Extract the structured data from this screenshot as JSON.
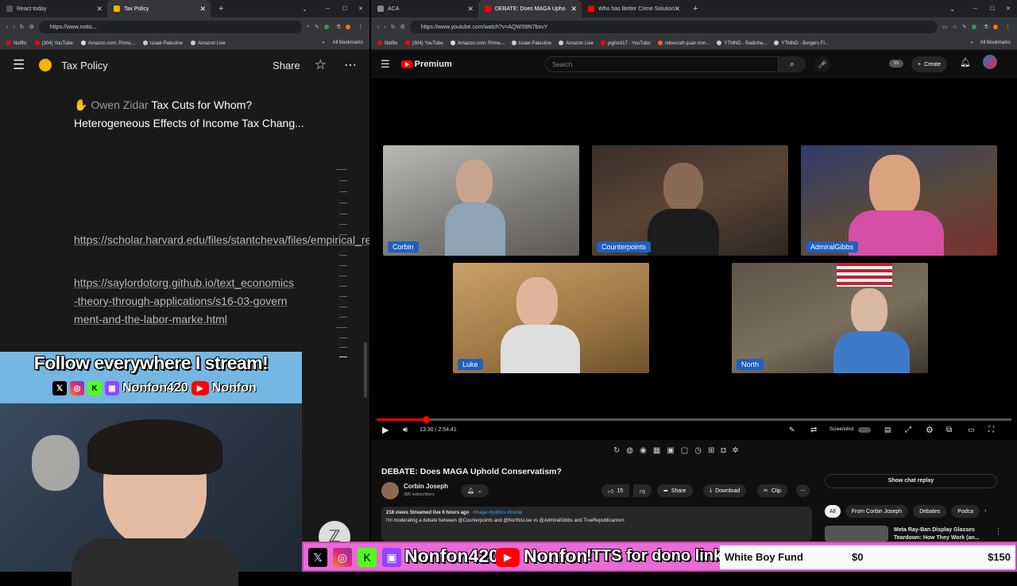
{
  "left_browser": {
    "tabs": [
      {
        "label": "React today",
        "active": false
      },
      {
        "label": "Tax Policy",
        "active": true
      }
    ],
    "url": "https://www.notio...",
    "bookmarks": [
      "Netflix",
      "(304) YouTube",
      "Amazon.com: Prime...",
      "Israel-Palestine",
      "Amazon Live"
    ],
    "all_bookmarks": "All Bookmarks"
  },
  "notion": {
    "page_title": "Tax Policy",
    "share": "Share",
    "author": "Owen  Zidar",
    "article_title": "Tax Cuts for Whom? Heterogeneous Effects of Income Tax Chang...",
    "link1": "https://scholar.harvard.edu/files/stantcheva/files/empirical_responses.pdf",
    "link2": "https://saylordotorg.github.io/text_economics-theory-through-applications/s16-03-government-and-the-labor-marke.html"
  },
  "overlay": {
    "follow": "Follow everywhere I stream!",
    "handle": "Nonfon420",
    "yt_handle": "Nonfon",
    "tts": "!TTS for dono link",
    "fund_name": "White Boy Fund",
    "fund_current": "$0",
    "fund_goal": "$150",
    "fund_progress": 0
  },
  "right_browser": {
    "tabs": [
      {
        "label": "ACA",
        "active": false
      },
      {
        "label": "DEBATE: Does MAGA Upho",
        "active": true
      },
      {
        "label": "Who has Better Crime Solution",
        "active": false
      }
    ],
    "url": "https://www.youtube.com/watch?v=AQWS9N7bxvY",
    "bookmarks": [
      "Netflix",
      "(304) YouTube",
      "Amazon.com: Prime...",
      "Israel-Palestine",
      "Amazon Live",
      "pigford17 - YouTube",
      "minecraft quan tron...",
      "YTMND - Radiohe...",
      "YTMND - Burgers Fl..."
    ],
    "all_bookmarks": "All Bookmarks"
  },
  "youtube": {
    "logo": "Premium",
    "search_placeholder": "Search",
    "create": "Create",
    "participants": [
      "Corbin",
      "Counterpoints",
      "AdmiralGibbs",
      "Luke",
      "North"
    ],
    "time": "13:30 / 2:54:41",
    "progress": 0.0773,
    "screenshot": "Screenshot",
    "title": "DEBATE: Does MAGA Uphold Conservatism?",
    "channel": "Corbin Joseph",
    "subs": "380 subscribers",
    "likes": "15",
    "share": "Share",
    "download": "Download",
    "clip": "Clip",
    "meta": "218 views  Streamed live 6 hours ago",
    "tags": "#maga #politics #trump",
    "description": "I'm moderating a debate between @Counterpoints and @NorthisLive vs @AdmiralGibbs and TrueRepublicanism",
    "chat_replay": "Show chat replay",
    "chips": [
      "All",
      "From Corbin Joseph",
      "Debates",
      "Podca"
    ],
    "rec_title": "Meta Ray-Ban Display Glasses",
    "rec_sub": "Teardown: How They Work (an..."
  },
  "colors": {
    "yt_red": "#ff0000",
    "name_tag": "#1e5fbf",
    "overlay_blue": "#74b7e2",
    "overlay_pink": "#e86bd6"
  }
}
